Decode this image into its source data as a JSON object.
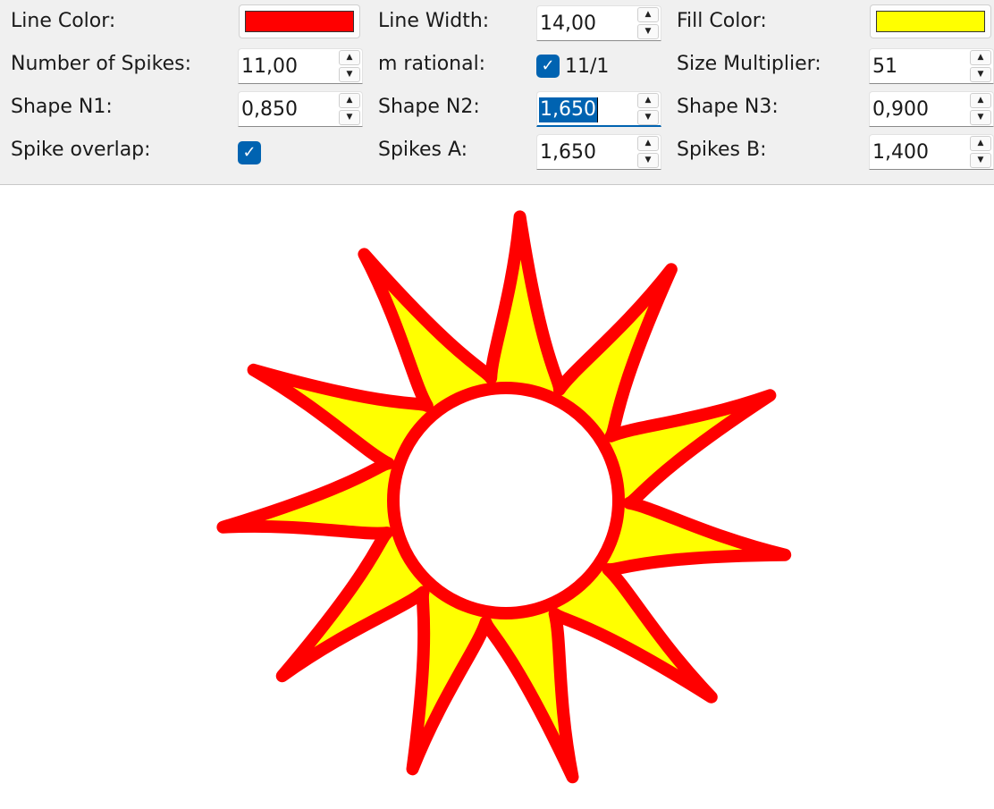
{
  "controls": {
    "line_color": {
      "label": "Line Color:",
      "color": "#ff0000"
    },
    "line_width": {
      "label": "Line Width:",
      "value": "14,00"
    },
    "fill_color": {
      "label": "Fill Color:",
      "color": "#ffff00"
    },
    "num_spikes": {
      "label": "Number of Spikes:",
      "value": "11,00"
    },
    "m_rational": {
      "label": "m rational:",
      "checked": true,
      "text": "11/1"
    },
    "size_multiplier": {
      "label": "Size Multiplier:",
      "value": "51"
    },
    "shape_n1": {
      "label": "Shape N1:",
      "value": "0,850"
    },
    "shape_n2": {
      "label": "Shape N2:",
      "value": "1,650"
    },
    "shape_n3": {
      "label": "Shape N3:",
      "value": "0,900"
    },
    "spike_overlap": {
      "label": "Spike overlap:",
      "checked": true
    },
    "spikes_a": {
      "label": "Spikes A:",
      "value": "1,650"
    },
    "spikes_b": {
      "label": "Spikes B:",
      "value": "1,400"
    }
  },
  "spinner_glyphs": {
    "up": "▲",
    "down": "▼"
  },
  "check_glyph": "✓",
  "shape": {
    "stroke_color": "#ff0000",
    "fill_color": "#ffff00",
    "spikes": 11
  }
}
